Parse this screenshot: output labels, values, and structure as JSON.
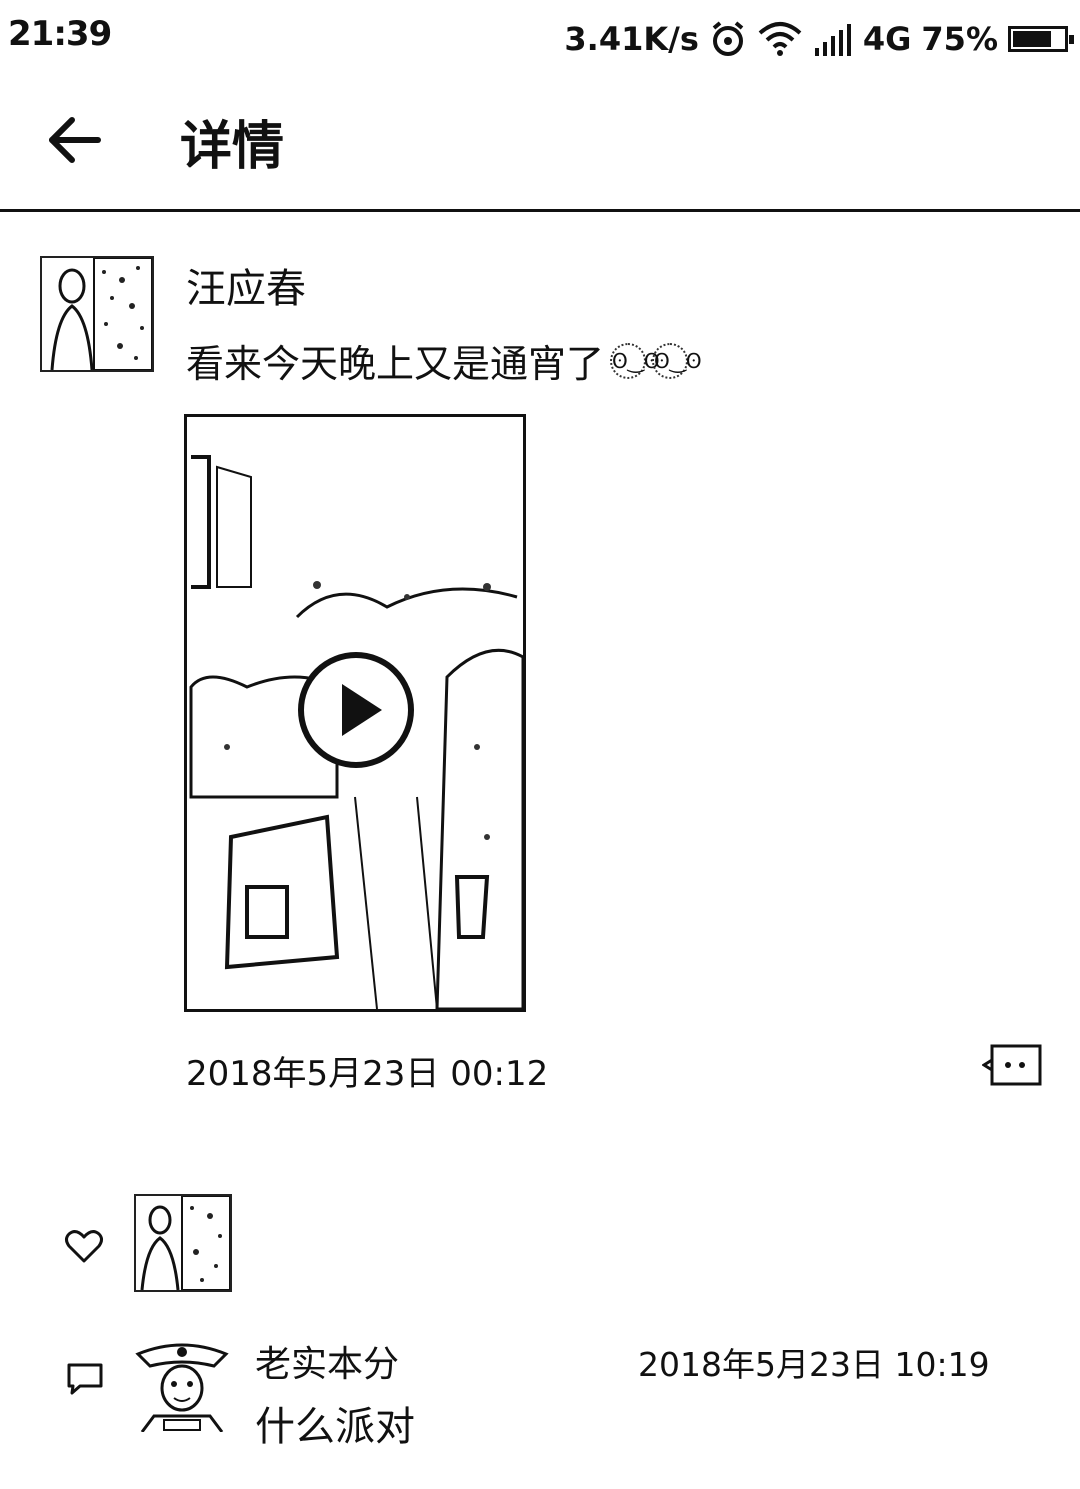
{
  "status_bar": {
    "time": "21:39",
    "net_speed": "3.41K/s",
    "network": "4G",
    "battery": "75%",
    "battery_level": 0.75
  },
  "header": {
    "title": "详情"
  },
  "post": {
    "author": "汪应春",
    "text": "看来今天晚上又是通宵了",
    "timestamp": "2018年5月23日 00:12"
  },
  "comments": [
    {
      "author": "老实本分",
      "time": "2018年5月23日 10:19",
      "text": "什么派对"
    }
  ]
}
